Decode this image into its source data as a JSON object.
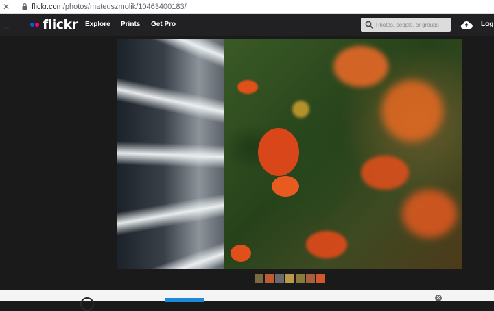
{
  "browser": {
    "url_host": "flickr.com",
    "url_path": "/photos/mateuszmolik/10463400183/",
    "close_glyph": "✕"
  },
  "nav": {
    "logo": "flickr",
    "links": [
      "Explore",
      "Prints",
      "Get Pro"
    ],
    "search_placeholder": "Photos, people, or groups",
    "login": "Log"
  },
  "breadcrumb": "...ns",
  "photo": {
    "thumbnail_count": 7
  },
  "bottom": {
    "close_glyph": "✕"
  },
  "colors": {
    "nav_bg": "#212124",
    "page_bg": "#1a1a1a",
    "logo_blue": "#0063dc",
    "logo_pink": "#ff0084",
    "berry": "#e0501a",
    "bottom_button": "#1c8ad8"
  },
  "icons": [
    "lock-icon",
    "search-icon",
    "upload-cloud-icon",
    "close-icon"
  ]
}
